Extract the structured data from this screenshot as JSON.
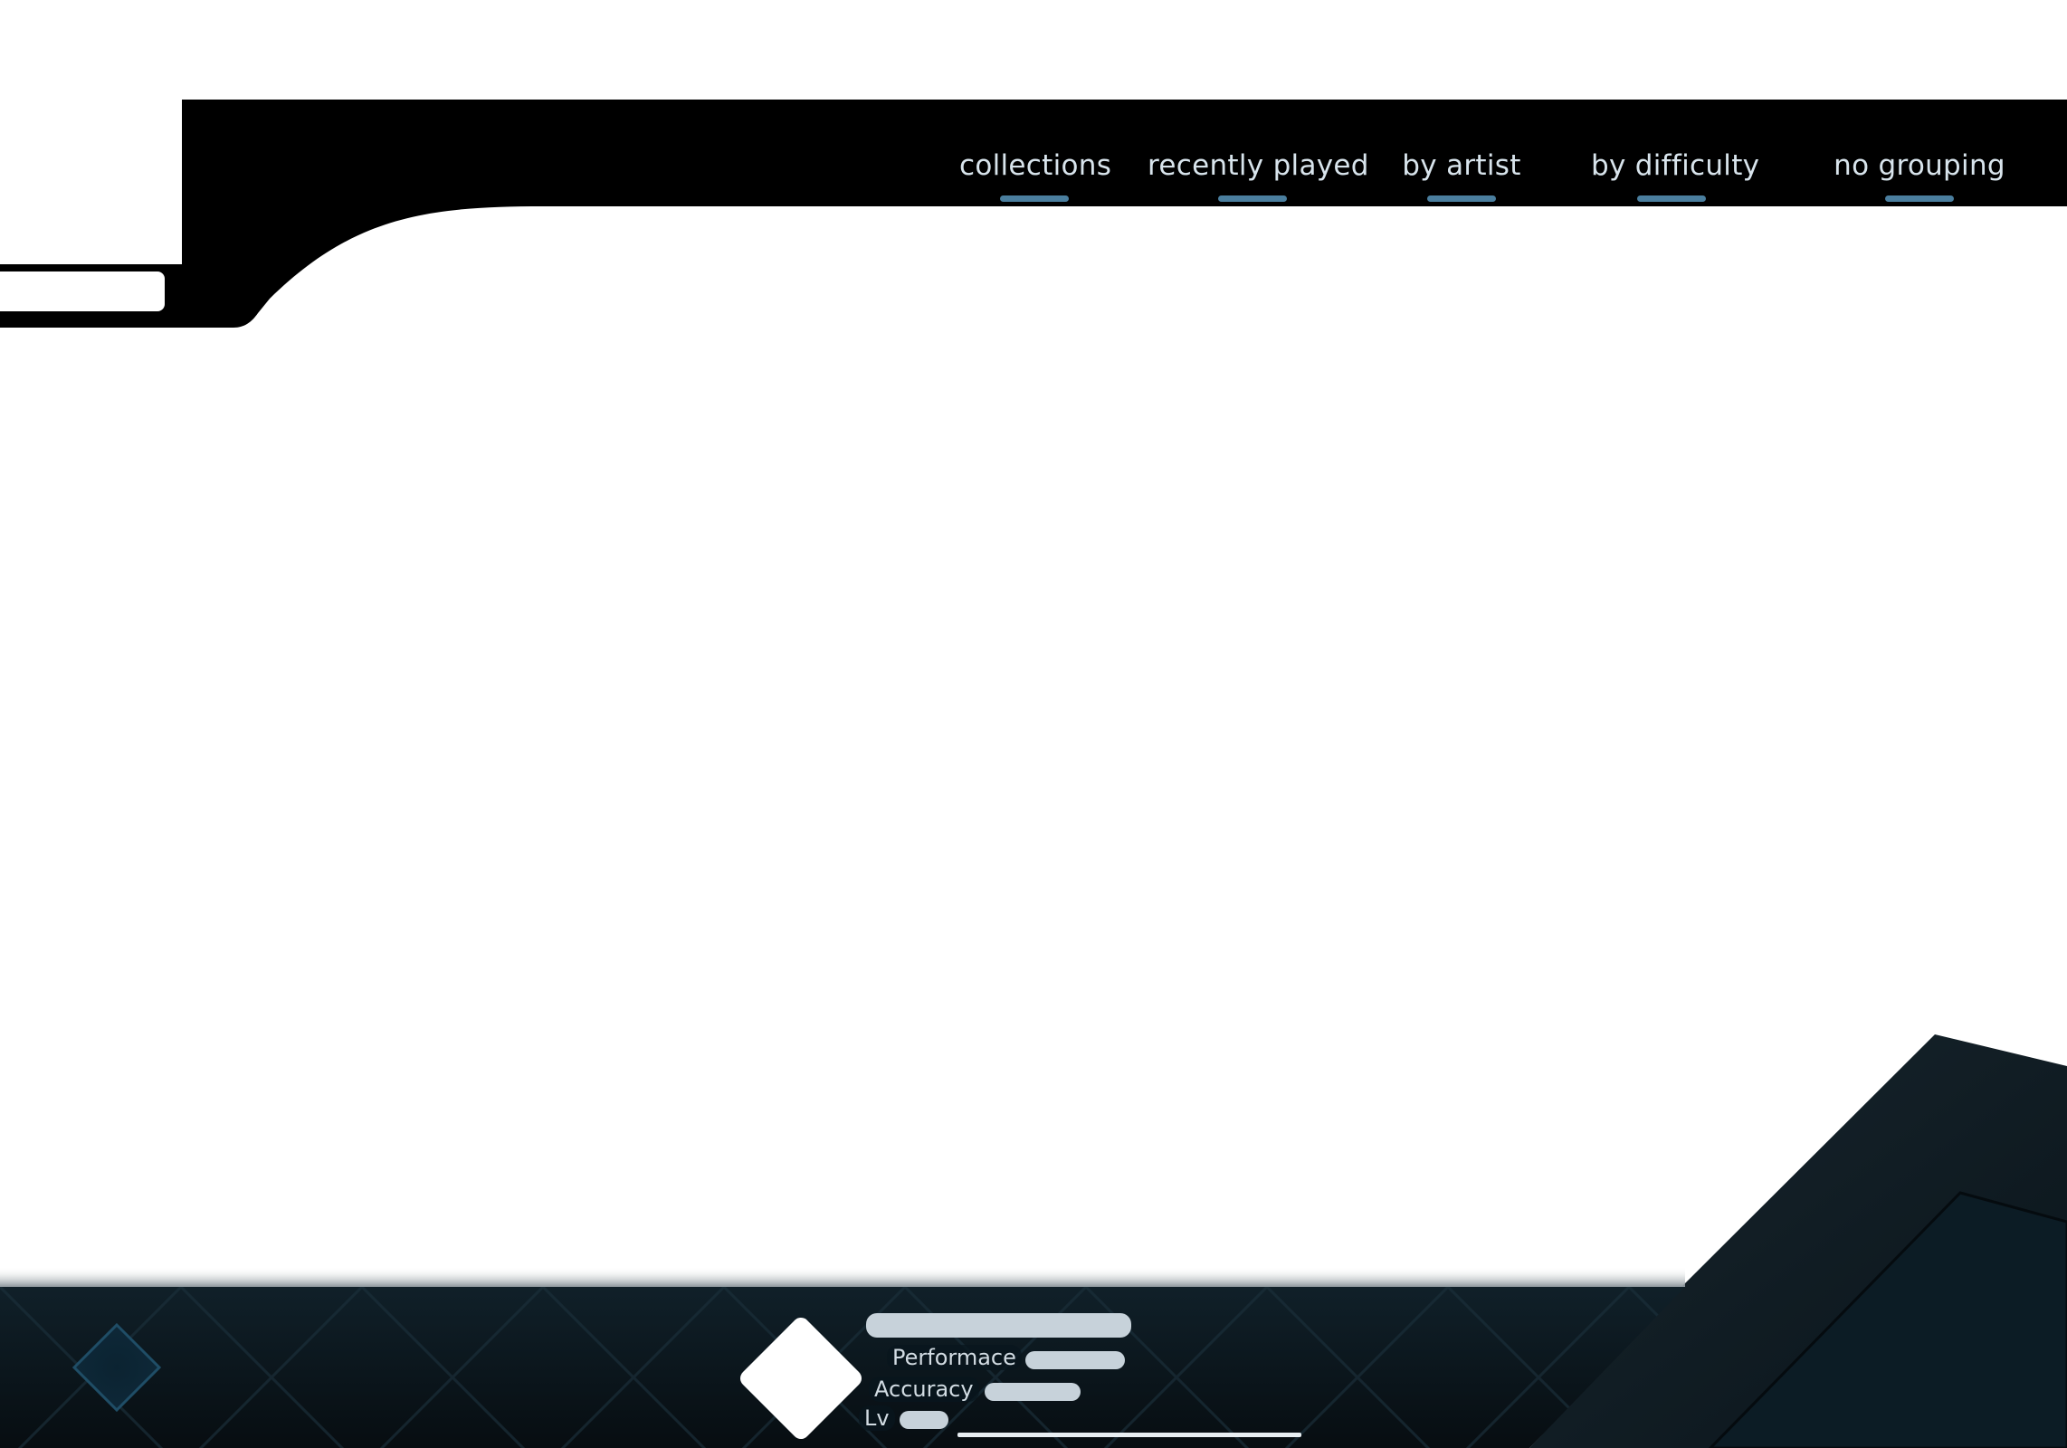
{
  "grouping_tabs": [
    {
      "label": "collections"
    },
    {
      "label": "recently played"
    },
    {
      "label": "by artist"
    },
    {
      "label": "by difficulty"
    },
    {
      "label": "no grouping"
    }
  ],
  "colors": {
    "header": "#000000",
    "tab_underline": "#4a7e9e",
    "footer": "#0b1820",
    "avatar": "#ffffff"
  },
  "icons": {
    "menu": "diamond-icon",
    "avatar": "diamond-avatar"
  },
  "player": {
    "performance_label": "Performace",
    "accuracy_label": "Accuracy",
    "level_label": "Lv"
  }
}
